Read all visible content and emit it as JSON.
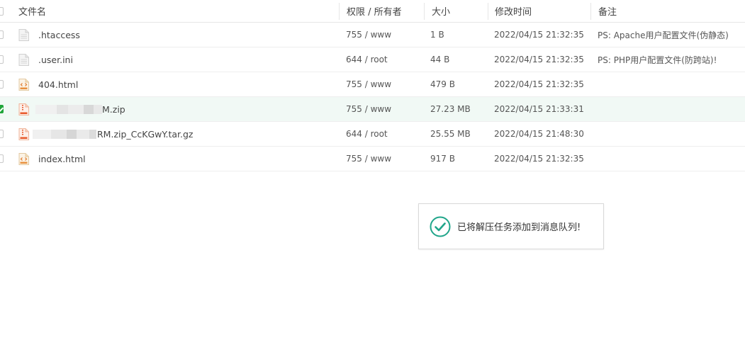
{
  "table": {
    "headers": {
      "name": "文件名",
      "permission": "权限 / 所有者",
      "size": "大小",
      "modified": "修改时间",
      "note": "备注"
    },
    "rows": [
      {
        "name": ".htaccess",
        "permission": "755 / www",
        "size": "1 B",
        "modified": "2022/04/15 21:32:35",
        "note": "PS: Apache用户配置文件(伪静态)",
        "icon": "text-file-icon",
        "selected": false
      },
      {
        "name": ".user.ini",
        "permission": "644 / root",
        "size": "44 B",
        "modified": "2022/04/15 21:32:35",
        "note": "PS: PHP用户配置文件(防跨站)!",
        "icon": "text-file-icon",
        "selected": false
      },
      {
        "name": "404.html",
        "permission": "755 / www",
        "size": "479 B",
        "modified": "2022/04/15 21:32:35",
        "note": "",
        "icon": "html-file-icon",
        "selected": false
      },
      {
        "name": "M.zip",
        "permission": "755 / www",
        "size": "27.23 MB",
        "modified": "2022/04/15 21:33:31",
        "note": "",
        "icon": "zip-file-icon",
        "selected": true
      },
      {
        "name": "RM.zip_CcKGwY.tar.gz",
        "permission": "644 / root",
        "size": "25.55 MB",
        "modified": "2022/04/15 21:48:30",
        "note": "",
        "icon": "zip-file-icon",
        "selected": false
      },
      {
        "name": "index.html",
        "permission": "755 / www",
        "size": "917 B",
        "modified": "2022/04/15 21:32:35",
        "note": "",
        "icon": "html-file-icon",
        "selected": false
      }
    ]
  },
  "toast": {
    "message": "已将解压任务添加到消息队列!",
    "icon": "success-check-icon"
  },
  "colors": {
    "accent": "#20a53a",
    "selected_row": "#f1f9f5",
    "toast_check": "#20a58a"
  }
}
